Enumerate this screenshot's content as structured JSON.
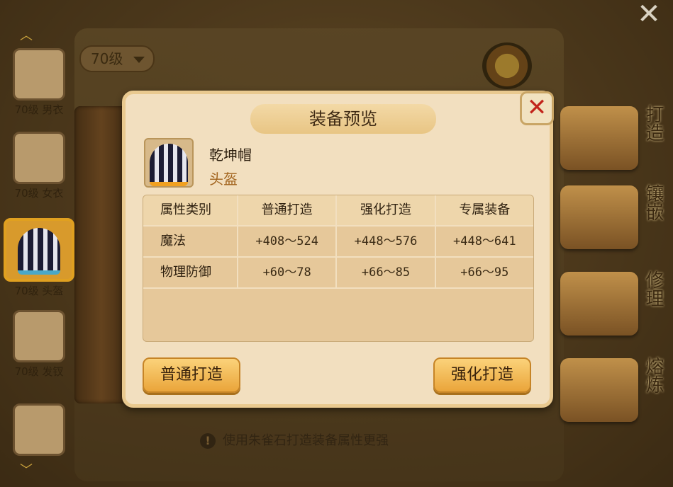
{
  "level_dropdown": "70级",
  "left_list": [
    {
      "label": "70级 男衣"
    },
    {
      "label": "70级 女衣"
    },
    {
      "label": "70级 头盔"
    },
    {
      "label": "70级 发钗"
    }
  ],
  "right_buttons": [
    "打造",
    "镶嵌",
    "修理",
    "熔炼"
  ],
  "hint": "使用朱雀石打造装备属性更强",
  "modal": {
    "title": "装备预览",
    "item_name": "乾坤帽",
    "item_type": "头盔",
    "table": {
      "headers": [
        "属性类别",
        "普通打造",
        "强化打造",
        "专属装备"
      ],
      "rows": [
        [
          "魔法",
          "+408～524",
          "+448～576",
          "+448～641"
        ],
        [
          "物理防御",
          "+60～78",
          "+66～85",
          "+66～95"
        ]
      ]
    },
    "btn_normal": "普通打造",
    "btn_enhanced": "强化打造"
  }
}
